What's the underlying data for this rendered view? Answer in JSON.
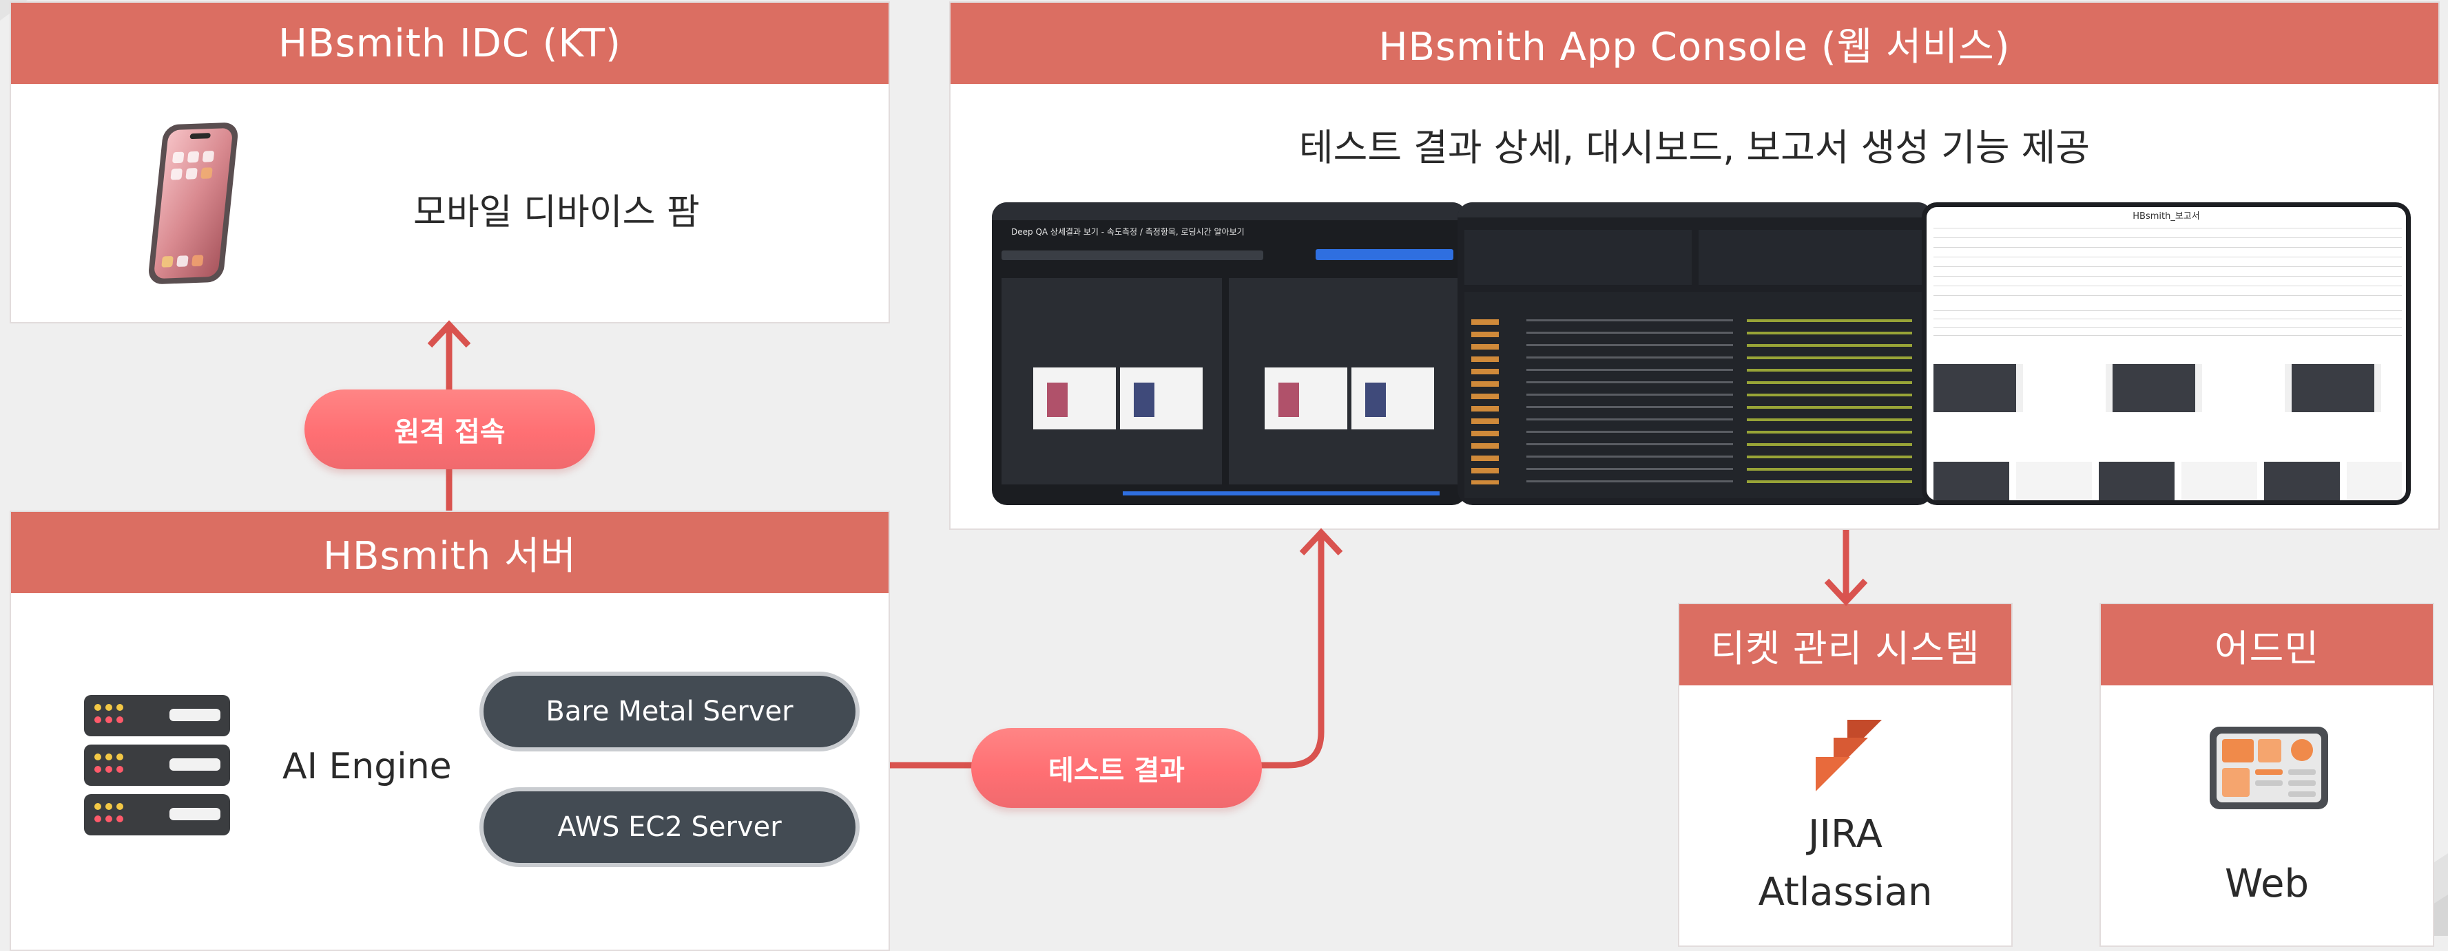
{
  "idc": {
    "title": "HBsmith IDC (KT)",
    "label": "모바일 디바이스 팜"
  },
  "remote_pill": "원격 접속",
  "server": {
    "title": "HBsmith 서버",
    "engine_label": "AI Engine",
    "bare_metal": "Bare Metal Server",
    "aws": "AWS EC2 Server"
  },
  "result_pill": "테스트 결과",
  "console": {
    "title": "HBsmith App Console (웹 서비스)",
    "subtitle": "테스트 결과 상세, 대시보드, 보고서 생성 기능 제공",
    "shot1_title": "Deep QA 상세결과 보기 - 속도측정 / 측정항목, 로딩시간 알아보기",
    "shot3_title": "HBsmith_보고서"
  },
  "ticket": {
    "title": "티켓 관리 시스템",
    "line1": "JIRA",
    "line2": "Atlassian"
  },
  "admin": {
    "title": "어드민",
    "label": "Web"
  },
  "colors": {
    "header": "#db6e62",
    "arrow": "#d9534f",
    "pill": "#ff7a7e",
    "dark_pill": "#434b53"
  }
}
